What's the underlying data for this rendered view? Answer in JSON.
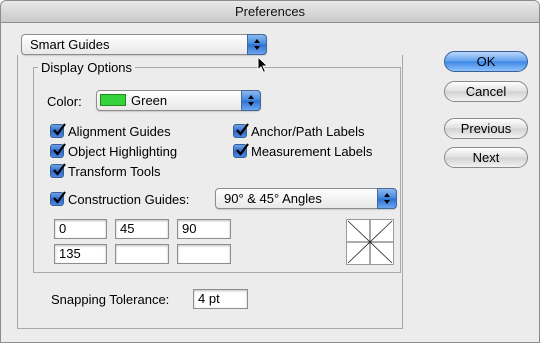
{
  "window": {
    "title": "Preferences"
  },
  "section_popup": {
    "value": "Smart Guides"
  },
  "display_options": {
    "title": "Display Options",
    "color_label": "Color:",
    "color_value": "Green",
    "color_swatch": "#36d23c",
    "checkboxes": {
      "alignment_guides": {
        "label": "Alignment Guides",
        "checked": true
      },
      "anchor_path_labels": {
        "label": "Anchor/Path Labels",
        "checked": true
      },
      "object_highlighting": {
        "label": "Object Highlighting",
        "checked": true
      },
      "measurement_labels": {
        "label": "Measurement Labels",
        "checked": true
      },
      "transform_tools": {
        "label": "Transform Tools",
        "checked": true
      },
      "construction_guides": {
        "label": "Construction Guides:",
        "checked": true
      }
    },
    "construction_angles": {
      "popup_value": "90° & 45° Angles",
      "angles": [
        "0",
        "45",
        "90",
        "135",
        "",
        ""
      ]
    }
  },
  "snapping": {
    "label": "Snapping Tolerance:",
    "value": "4 pt"
  },
  "buttons": {
    "ok": "OK",
    "cancel": "Cancel",
    "previous": "Previous",
    "next": "Next"
  },
  "colors": {
    "accent": "#3c86e6",
    "window_bg": "#ececec"
  }
}
